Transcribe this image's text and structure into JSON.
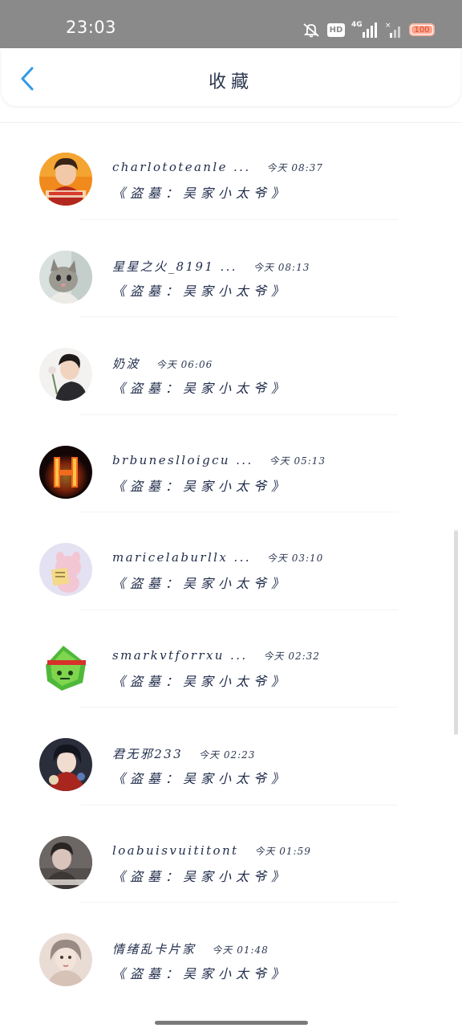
{
  "status_bar": {
    "time": "23:03",
    "hd_label": "HD",
    "network_label": "4G",
    "battery": "100",
    "battery_level": 1.0,
    "icons": [
      "mute-bell-icon",
      "hd-icon",
      "signal-4g-icon",
      "signal-2-icon",
      "battery-icon"
    ]
  },
  "header": {
    "title": "收藏",
    "back_icon": "chevron-left-icon",
    "accent": "#2f9ae8"
  },
  "items": [
    {
      "name": "charlototeanle ...",
      "time": "今天 08:37",
      "subtitle": "《盗墓：吴家小太爷》"
    },
    {
      "name": "星星之火_8191 ...",
      "time": "今天 08:13",
      "subtitle": "《盗墓：吴家小太爷》"
    },
    {
      "name": "奶波",
      "time": "今天 06:06",
      "subtitle": "《盗墓：吴家小太爷》"
    },
    {
      "name": "brbuneslloigcu ...",
      "time": "今天 05:13",
      "subtitle": "《盗墓：吴家小太爷》"
    },
    {
      "name": "maricelaburllx ...",
      "time": "今天 03:10",
      "subtitle": "《盗墓：吴家小太爷》"
    },
    {
      "name": "smarkvtforrxu ...",
      "time": "今天 02:32",
      "subtitle": "《盗墓：吴家小太爷》"
    },
    {
      "name": "君无邪233",
      "time": "今天 02:23",
      "subtitle": "《盗墓：吴家小太爷》"
    },
    {
      "name": "loabuisvuititont",
      "time": "今天 01:59",
      "subtitle": "《盗墓：吴家小太爷》"
    },
    {
      "name": "情绪乱卡片家",
      "time": "今天 01:48",
      "subtitle": "《盗墓：吴家小太爷》"
    }
  ]
}
